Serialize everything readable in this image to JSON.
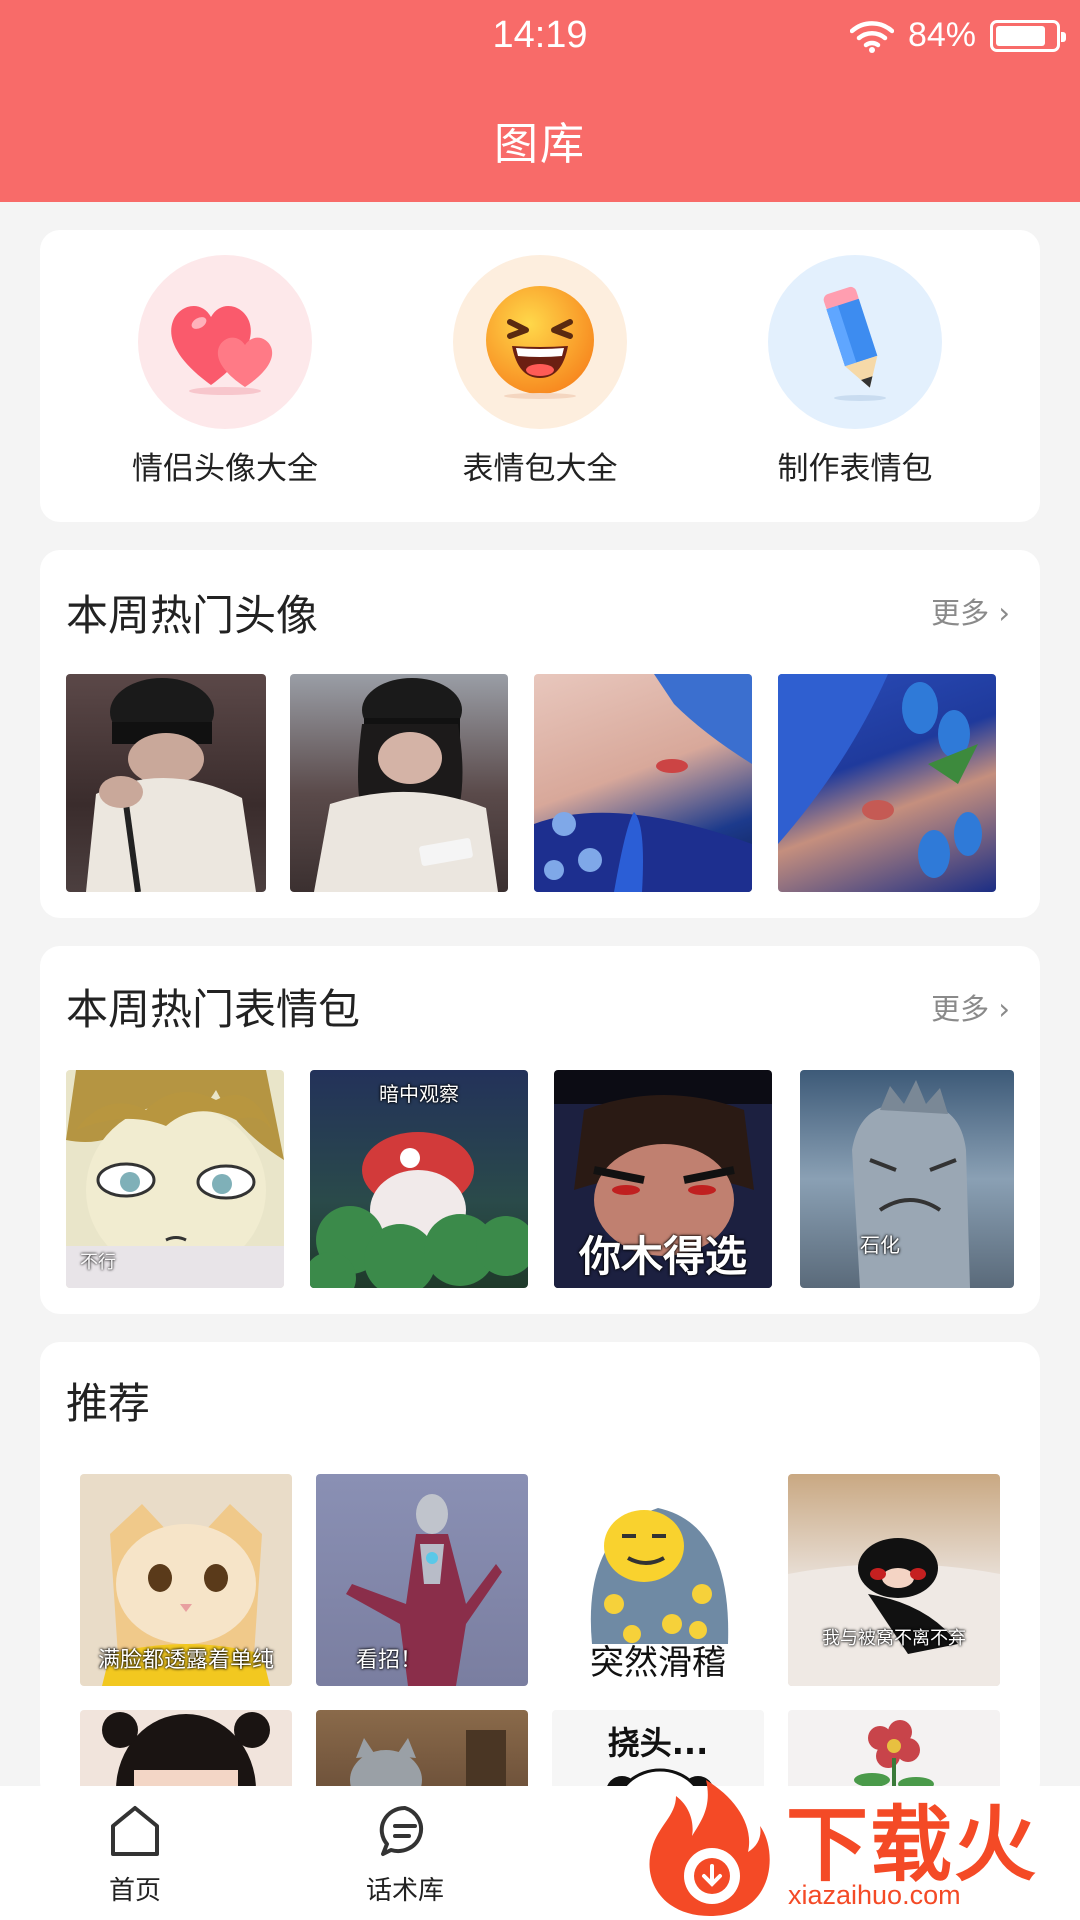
{
  "status": {
    "time": "14:19",
    "battery": "84%",
    "battery_level": 0.84
  },
  "header": {
    "title": "图库"
  },
  "quick_actions": [
    {
      "label": "情侣头像大全",
      "icon": "heart-icon"
    },
    {
      "label": "表情包大全",
      "icon": "laughing-face-icon"
    },
    {
      "label": "制作表情包",
      "icon": "pencil-icon"
    }
  ],
  "hot_avatars": {
    "title": "本周热门头像",
    "more": "更多",
    "items": [
      {
        "name": "avatar-couple-1"
      },
      {
        "name": "avatar-couple-2"
      },
      {
        "name": "avatar-blue-hair-1"
      },
      {
        "name": "avatar-blue-hair-2"
      }
    ]
  },
  "hot_stickers": {
    "title": "本周热门表情包",
    "more": "更多",
    "items": [
      {
        "caption": "不行"
      },
      {
        "caption": "暗中观察"
      },
      {
        "caption": "你木得选"
      },
      {
        "caption": "石化"
      }
    ]
  },
  "recommend": {
    "title": "推荐",
    "row1": [
      {
        "caption": "满脸都透露着单纯"
      },
      {
        "caption": "看招！"
      },
      {
        "caption": "突然滑稽"
      },
      {
        "caption": "我与被窝不离不弃"
      }
    ],
    "row2": [
      {
        "caption": ""
      },
      {
        "caption": ""
      },
      {
        "caption": "挠头..."
      },
      {
        "caption": ""
      }
    ]
  },
  "nav": {
    "home": "首页",
    "phrases": "话术库"
  },
  "watermark": {
    "text": "下载火",
    "url": "xiazaihuo.com"
  },
  "colors": {
    "accent": "#f86b69",
    "watermark": "#f44a26"
  }
}
